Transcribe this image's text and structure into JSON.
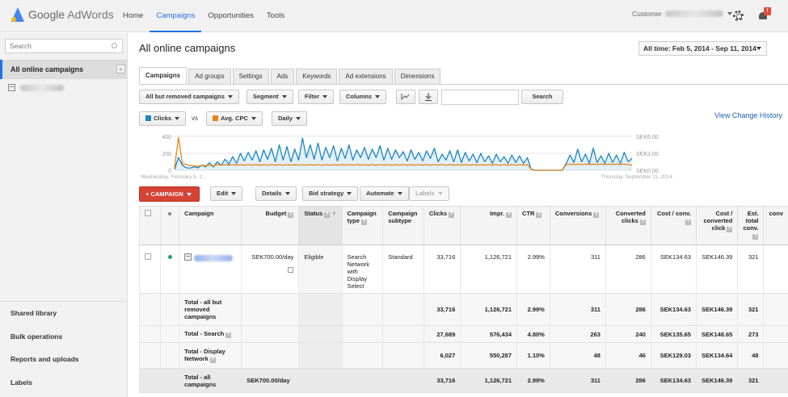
{
  "header": {
    "logo_google": "Google",
    "logo_product": "AdWords",
    "nav": [
      {
        "label": "Home"
      },
      {
        "label": "Campaigns",
        "active": true
      },
      {
        "label": "Opportunities"
      },
      {
        "label": "Tools"
      }
    ],
    "customer_label": "Customer",
    "notification_count": "!"
  },
  "sidebar": {
    "search_placeholder": "Search",
    "active_item": "All online campaigns",
    "collapse_label": "«",
    "bottom_items": [
      "Shared library",
      "Bulk operations",
      "Reports and uploads",
      "Labels"
    ]
  },
  "main": {
    "title": "All online campaigns",
    "date_range": "All time: Feb 5, 2014 - Sep 11, 2014",
    "tabs": [
      "Campaigns",
      "Ad groups",
      "Settings",
      "Ads",
      "Keywords",
      "Ad extensions",
      "Dimensions"
    ],
    "toolbar": {
      "filter_scope": "All but removed campaigns",
      "segment": "Segment",
      "filter": "Filter",
      "columns": "Columns",
      "search_button": "Search"
    },
    "metrics": {
      "metric1": "Clicks",
      "metric1_color": "#1b86c8",
      "vs": "vs",
      "metric2": "Avg. CPC",
      "metric2_color": "#e8821a",
      "interval": "Daily"
    },
    "view_change_history": "View Change History",
    "actions": {
      "add_campaign": "+ CAMPAIGN",
      "edit": "Edit",
      "details": "Details",
      "bid_strategy": "Bid strategy",
      "automate": "Automate",
      "labels": "Labels"
    }
  },
  "chart_data": {
    "type": "line",
    "x_start_label": "Wednesday, February 5, 2...",
    "x_end_label": "Thursday, September 11, 2014",
    "y_left_ticks": [
      "400",
      "200",
      "0"
    ],
    "y_right_ticks": [
      "SEK6.00",
      "SEK3.00",
      "SEK0.00"
    ],
    "ylim_left": [
      0,
      400
    ],
    "ylim_right": [
      0,
      6
    ],
    "series": [
      {
        "name": "Clicks",
        "axis": "left",
        "color": "#1b86c8",
        "values": [
          10,
          150,
          60,
          30,
          25,
          40,
          30,
          60,
          40,
          90,
          40,
          100,
          60,
          130,
          70,
          160,
          80,
          200,
          110,
          210,
          120,
          230,
          100,
          240,
          130,
          260,
          100,
          300,
          120,
          280,
          100,
          250,
          120,
          380,
          150,
          300,
          130,
          320,
          120,
          270,
          150,
          290,
          110,
          260,
          140,
          300,
          120,
          240,
          150,
          270,
          130,
          250,
          150,
          290,
          120,
          260,
          130,
          240,
          150,
          220,
          110,
          240,
          130,
          210,
          110,
          230,
          140,
          260,
          100,
          190,
          120,
          230,
          100,
          240,
          90,
          210,
          110,
          190,
          90,
          200,
          100,
          170,
          80,
          190,
          100,
          160,
          80,
          180,
          90,
          170,
          80,
          150,
          10,
          0,
          0,
          0,
          0,
          0,
          0,
          0,
          0,
          80,
          180,
          90,
          250,
          100,
          190,
          80,
          260,
          90,
          170,
          80,
          200,
          90,
          180,
          80,
          210,
          100,
          140
        ]
      },
      {
        "name": "Avg. CPC",
        "axis": "right",
        "color": "#e8821a",
        "values": [
          0.4,
          5.8,
          1.2,
          1.0,
          0.8,
          0.8,
          0.7,
          0.9,
          0.8,
          0.9,
          0.8,
          1.0,
          0.9,
          1.0,
          0.9,
          1.0,
          0.9,
          1.0,
          0.9,
          1.0,
          0.9,
          1.0,
          0.9,
          1.0,
          0.9,
          1.0,
          0.9,
          1.0,
          0.9,
          1.0,
          0.9,
          1.0,
          0.9,
          1.0,
          0.9,
          1.0,
          0.9,
          1.0,
          0.9,
          1.0,
          0.9,
          1.0,
          0.9,
          1.0,
          0.9,
          1.0,
          0.9,
          1.0,
          0.9,
          1.0,
          0.9,
          1.0,
          0.9,
          1.0,
          0.9,
          1.0,
          0.9,
          1.0,
          0.9,
          1.0,
          0.9,
          1.0,
          0.9,
          1.0,
          0.9,
          1.0,
          0.9,
          1.0,
          0.9,
          1.0,
          0.9,
          1.0,
          0.9,
          1.0,
          0.9,
          1.0,
          0.9,
          1.0,
          0.9,
          1.0,
          0.9,
          1.0,
          0.9,
          1.0,
          0.9,
          1.0,
          0.9,
          1.0,
          0.9,
          1.0,
          0.9,
          1.0,
          0.2,
          0,
          0,
          0,
          0,
          0,
          0,
          0,
          0,
          1.0,
          1.1,
          1.0,
          1.1,
          1.0,
          1.1,
          1.0,
          1.1,
          1.0,
          1.1,
          1.0,
          1.1,
          1.0,
          1.1,
          1.0,
          1.1,
          1.0,
          0.9
        ]
      }
    ]
  },
  "table": {
    "headers": {
      "campaign": "Campaign",
      "budget": "Budget",
      "status": "Status",
      "campaign_type": "Campaign type",
      "campaign_subtype": "Campaign subtype",
      "clicks": "Clicks",
      "impr": "Impr.",
      "ctr": "CTR",
      "conversions": "Conversions",
      "converted_clicks": "Converted clicks",
      "cost_conv": "Cost / conv.",
      "cost_converted_click": "Cost / converted click",
      "est_total_conv": "Est. total conv.",
      "cut": "conv"
    },
    "rows": [
      {
        "budget": "SEK700.00/day",
        "status": "Eligible",
        "type": "Search Network with Display Select",
        "subtype": "Standard",
        "clicks": "33,716",
        "impr": "1,126,721",
        "ctr": "2.99%",
        "conversions": "311",
        "converted_clicks": "286",
        "cost_conv": "SEK134.63",
        "cost_cc": "SEK146.39",
        "est": "321"
      }
    ],
    "totals": [
      {
        "label": "Total - all but removed campaigns",
        "clicks": "33,716",
        "impr": "1,126,721",
        "ctr": "2.99%",
        "conversions": "311",
        "converted_clicks": "286",
        "cost_conv": "SEK134.63",
        "cost_cc": "SEK146.39",
        "est": "321"
      },
      {
        "label": "Total - Search",
        "clicks": "27,689",
        "impr": "576,434",
        "ctr": "4.80%",
        "conversions": "263",
        "converted_clicks": "240",
        "cost_conv": "SEK135.65",
        "cost_cc": "SEK148.65",
        "est": "273"
      },
      {
        "label": "Total - Display Network",
        "clicks": "6,027",
        "impr": "550,287",
        "ctr": "1.10%",
        "conversions": "48",
        "converted_clicks": "46",
        "cost_conv": "SEK129.03",
        "cost_cc": "SEK134.64",
        "est": "48"
      }
    ],
    "grand_total": {
      "label": "Total - all campaigns",
      "budget": "SEK700.00/day",
      "clicks": "33,716",
      "impr": "1,126,721",
      "ctr": "2.99%",
      "conversions": "311",
      "converted_clicks": "286",
      "cost_conv": "SEK134.63",
      "cost_cc": "SEK146.39",
      "est": "321"
    }
  }
}
